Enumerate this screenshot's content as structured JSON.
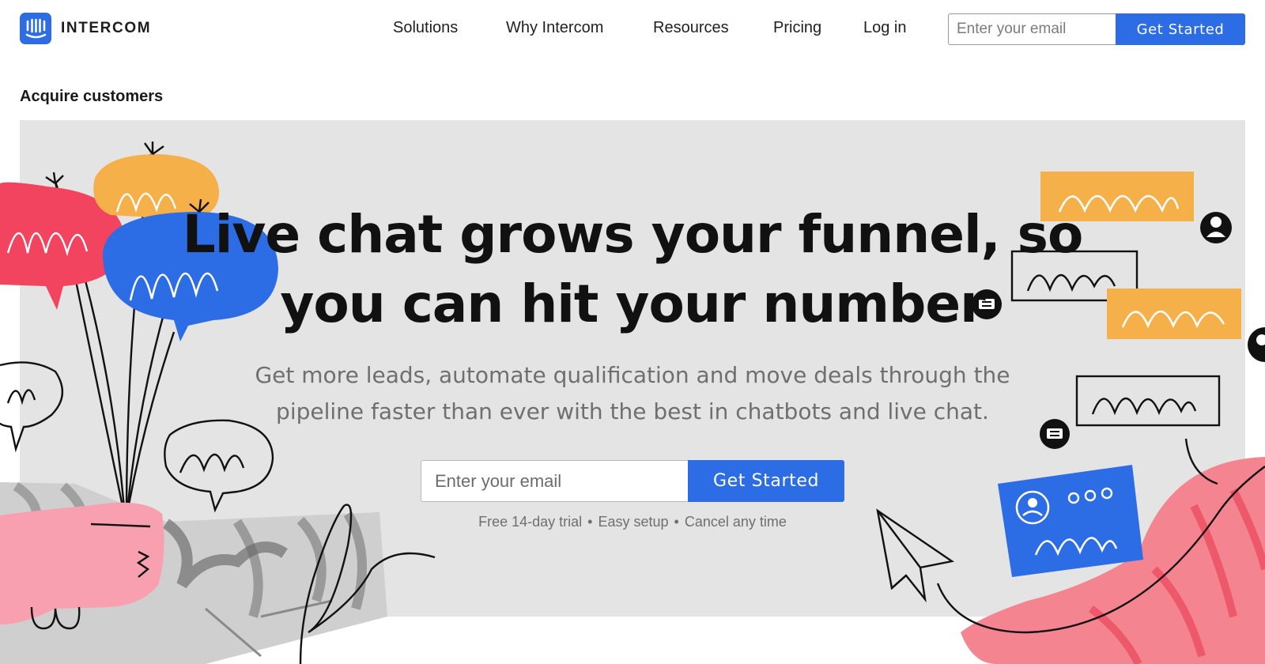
{
  "header": {
    "logo_icon": "intercom-logo-icon",
    "logo_text": "INTERCOM",
    "nav": [
      {
        "label": "Solutions"
      },
      {
        "label": "Why Intercom"
      },
      {
        "label": "Resources"
      },
      {
        "label": "Pricing"
      },
      {
        "label": "Log in"
      }
    ],
    "email_placeholder": "Enter your email",
    "cta_label": "Get Started"
  },
  "eyebrow": "Acquire customers",
  "hero": {
    "headline_line1": "Live chat grows your funnel, so",
    "headline_line2": "you can hit your number",
    "subtext_line1": "Get more leads, automate qualification and move deals through the",
    "subtext_line2": "pipeline faster than ever with the best in chatbots and live chat.",
    "email_placeholder": "Enter your email",
    "cta_label": "Get Started",
    "perks": [
      "Free 14-day trial",
      "Easy setup",
      "Cancel any time"
    ],
    "perk_separator": "•"
  },
  "colors": {
    "brand_blue": "#2c6ce4",
    "hero_background": "#e4e4e4",
    "balloon_red": "#f2445f",
    "balloon_orange": "#f5b04a",
    "hand_pink": "#f8a0b0"
  }
}
